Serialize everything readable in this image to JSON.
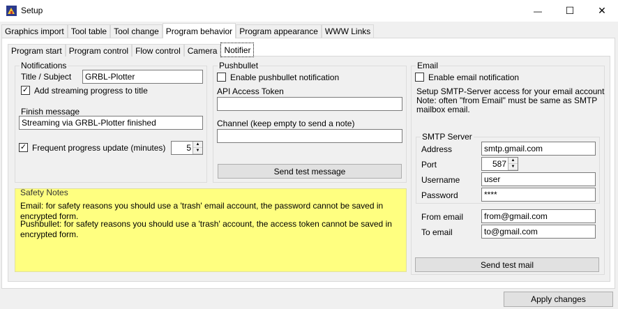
{
  "window": {
    "title": "Setup",
    "minimize_glyph": "—",
    "maximize_glyph": "☐",
    "close_glyph": "✕"
  },
  "main_tabs": [
    {
      "label": "Graphics import"
    },
    {
      "label": "Tool table"
    },
    {
      "label": "Tool change"
    },
    {
      "label": "Program behavior"
    },
    {
      "label": "Program appearance"
    },
    {
      "label": "WWW Links"
    }
  ],
  "sub_tabs": [
    {
      "label": "Program start"
    },
    {
      "label": "Program control"
    },
    {
      "label": "Flow control"
    },
    {
      "label": "Camera"
    },
    {
      "label": "Notifier"
    }
  ],
  "notifications": {
    "legend": "Notifications",
    "title_label": "Title / Subject",
    "title_value": "GRBL-Plotter",
    "add_progress_label": "Add streaming progress to title",
    "add_progress_checked": true,
    "finish_label": "Finish message",
    "finish_value": "Streaming via GRBL-Plotter finished",
    "frequent_label": "Frequent progress update (minutes)",
    "frequent_checked": true,
    "frequent_value": "5"
  },
  "pushbullet": {
    "legend": "Pushbullet",
    "enable_label": "Enable pushbullet notification",
    "enable_checked": false,
    "token_label": "API Access Token",
    "token_value": "",
    "channel_label": "Channel (keep empty to send a note)",
    "channel_value": "",
    "test_button": "Send test message"
  },
  "safety": {
    "legend": "Safety Notes",
    "email_note": "Email: for safety reasons you should use a 'trash' email account, the password cannot be saved in encrypted form.",
    "pushbullet_note": "Pushbullet: for safety reasons you should use a 'trash' account, the access token cannot be saved in encrypted form."
  },
  "email": {
    "legend": "Email",
    "enable_label": "Enable email notification",
    "enable_checked": false,
    "info_line1": "Setup SMTP-Server access for your email account",
    "info_line2": "Note: often \"from Email\" must be same as SMTP",
    "info_line3": "mailbox email.",
    "smtp_legend": "SMTP Server",
    "address_label": "Address",
    "address_value": "smtp.gmail.com",
    "port_label": "Port",
    "port_value": "587",
    "username_label": "Username",
    "username_value": "user",
    "password_label": "Password",
    "password_value": "****",
    "from_label": "From email",
    "from_value": "from@gmail.com",
    "to_label": "To email",
    "to_value": "to@gmail.com",
    "test_button": "Send test mail"
  },
  "footer": {
    "apply_button": "Apply changes"
  }
}
